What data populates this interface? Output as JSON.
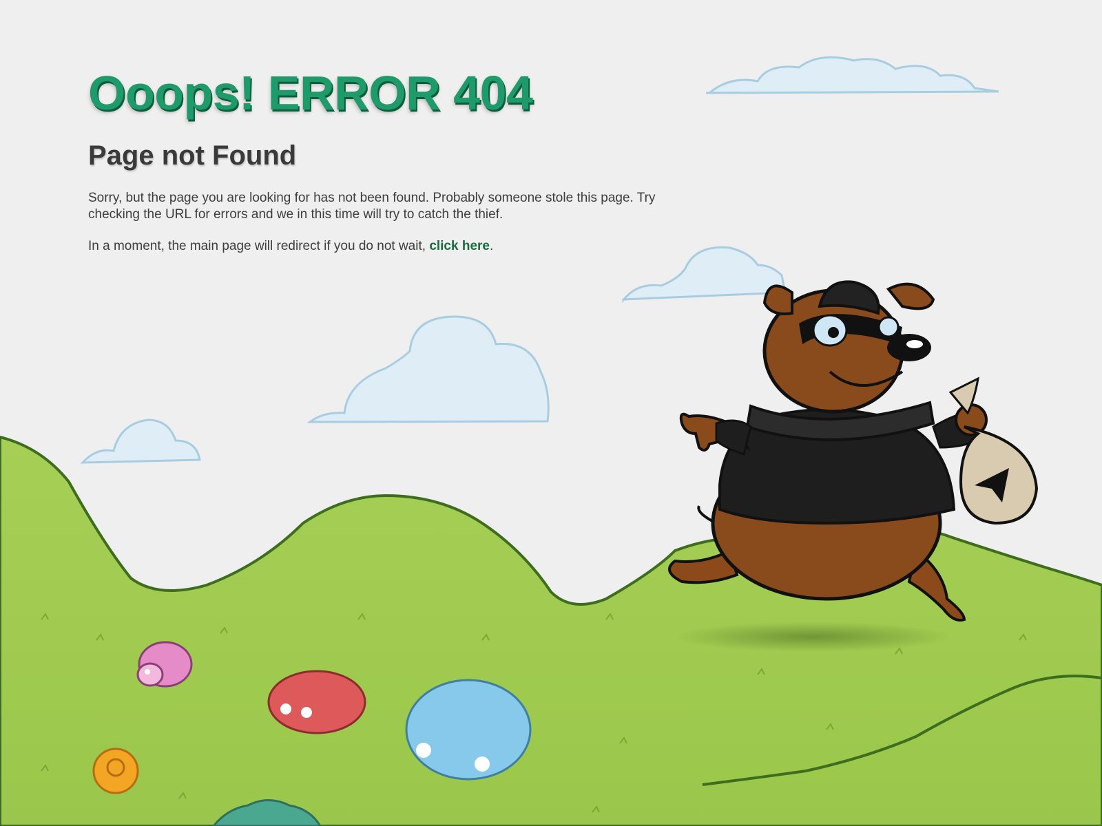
{
  "error": {
    "title": "Ooops! ERROR 404",
    "subtitle": "Page not Found",
    "message": "Sorry, but the page you are looking for has not been found. Probably someone stole this page. Try checking the URL for errors and we in this time will try to catch the thief.",
    "redirect_text": "In a moment, the main page will redirect if you do not wait, ",
    "link_label": "click here",
    "redirect_end": "."
  },
  "colors": {
    "title_green": "#1f9a6a",
    "link_green": "#176b3f",
    "grass": "#a8d05a",
    "sky": "#f0f0f0"
  },
  "illustration": {
    "character": "thief-dog-icon",
    "bag": "loot-bag-icon",
    "creatures": [
      "pink-sheep-icon",
      "red-sheep-icon",
      "blue-sheep-icon",
      "orange-snail-icon",
      "teal-bush-icon"
    ]
  }
}
